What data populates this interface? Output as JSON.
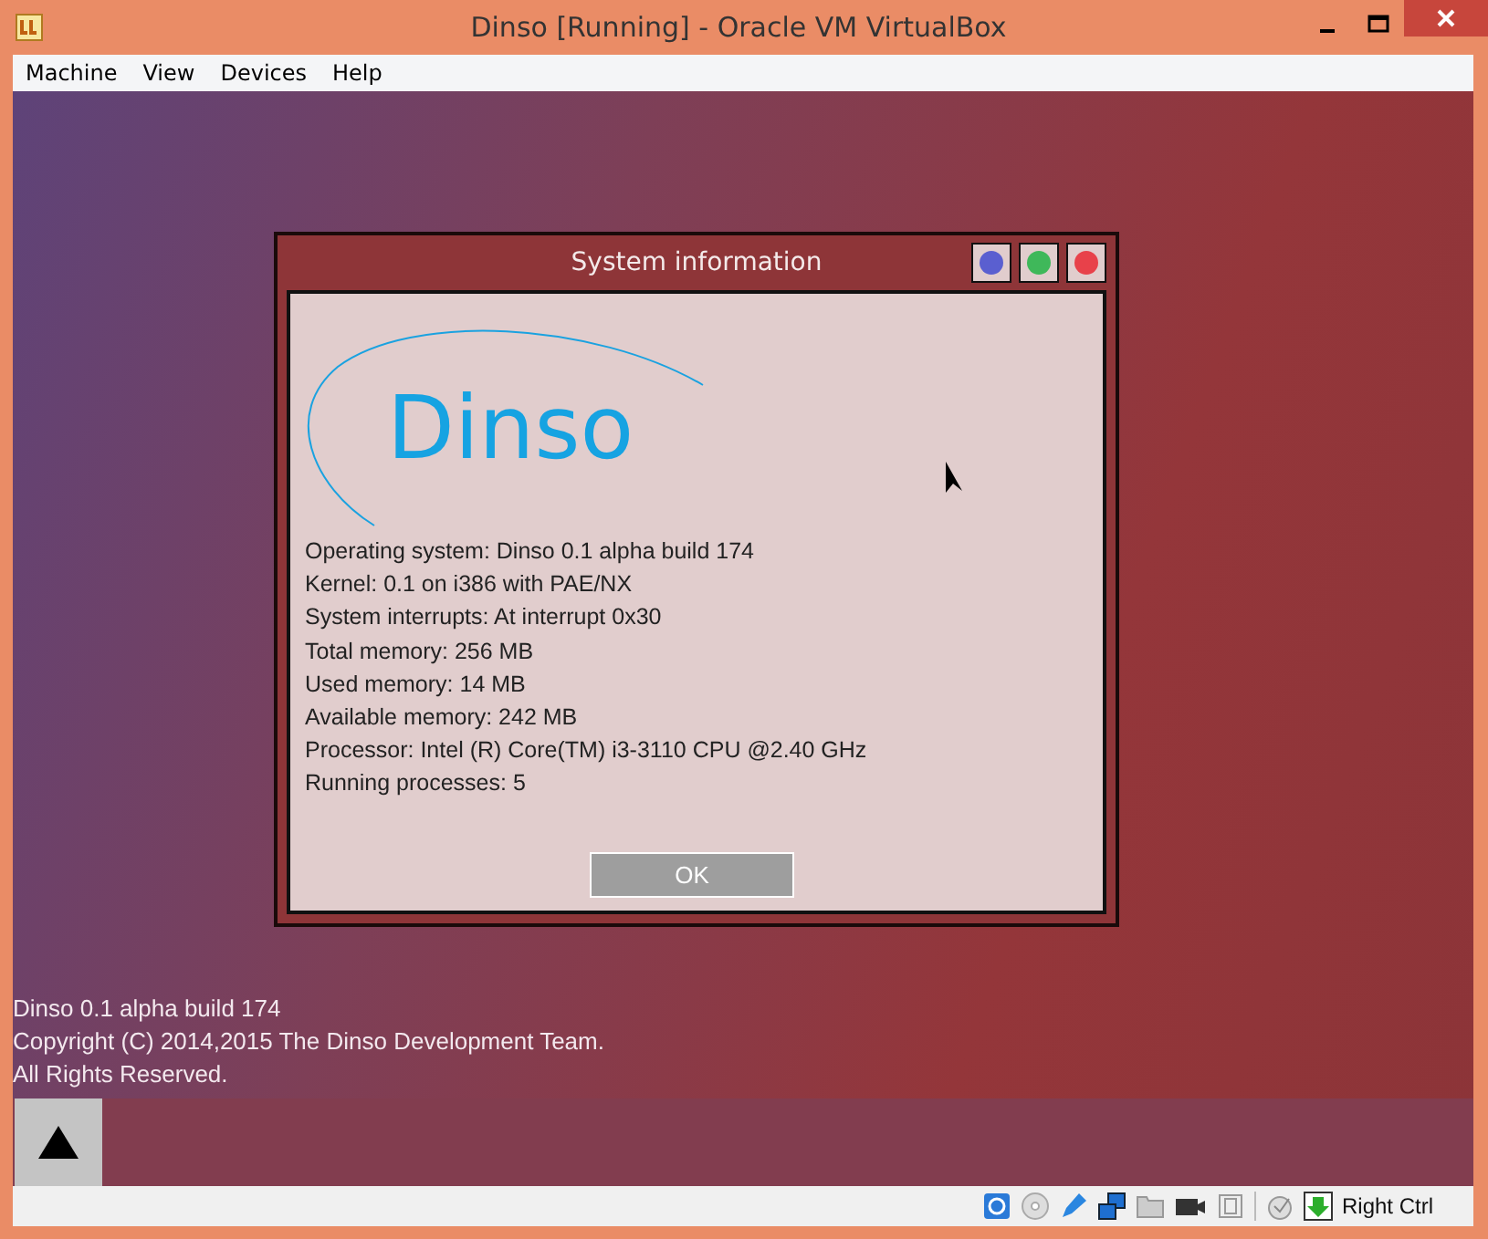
{
  "window": {
    "title": "Dinso [Running] - Oracle VM VirtualBox"
  },
  "menu": [
    "Machine",
    "View",
    "Devices",
    "Help"
  ],
  "dialog": {
    "title": "System information",
    "controls": [
      {
        "color": "#5a5fd0"
      },
      {
        "color": "#3fb85a"
      },
      {
        "color": "#e8414a"
      }
    ],
    "logo": "Dinso",
    "lines": [
      "Operating system: Dinso 0.1 alpha build 174",
      "Kernel: 0.1 on i386 with PAE/NX",
      "System interrupts: At interrupt 0x30",
      "Total memory: 256 MB",
      "Used memory: 14 MB",
      "Available memory: 242 MB",
      "Processor: Intel (R) Core(TM) i3-3110 CPU @2.40 GHz",
      "Running processes: 5"
    ],
    "button": "OK"
  },
  "boot_text": [
    "Dinso 0.1 alpha build 174",
    "Copyright (C) 2014,2015 The Dinso Development Team.",
    "All Rights Reserved."
  ],
  "status_bar": {
    "host_key": "Right Ctrl"
  }
}
